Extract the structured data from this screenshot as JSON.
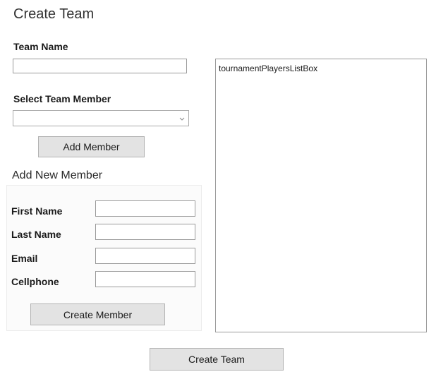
{
  "window": {
    "title": "Create Team"
  },
  "team_name": {
    "label": "Team Name",
    "value": ""
  },
  "select_member": {
    "label": "Select Team Member",
    "selected": "",
    "dropdown_icon": "chevron-down-icon"
  },
  "buttons": {
    "add_member": "Add Member",
    "create_member": "Create Member",
    "create_team": "Create Team"
  },
  "new_member_group": {
    "title": "Add New Member",
    "fields": [
      {
        "label": "First Name",
        "value": ""
      },
      {
        "label": "Last Name",
        "value": ""
      },
      {
        "label": "Email",
        "value": ""
      },
      {
        "label": "Cellphone",
        "value": ""
      }
    ]
  },
  "players_listbox": {
    "items": [
      "tournamentPlayersListBox"
    ]
  },
  "colors": {
    "button_bg": "#e3e3e3",
    "button_border": "#b3b3b3",
    "input_border": "#9a9a9a",
    "group_bg": "#fbfbfb"
  }
}
